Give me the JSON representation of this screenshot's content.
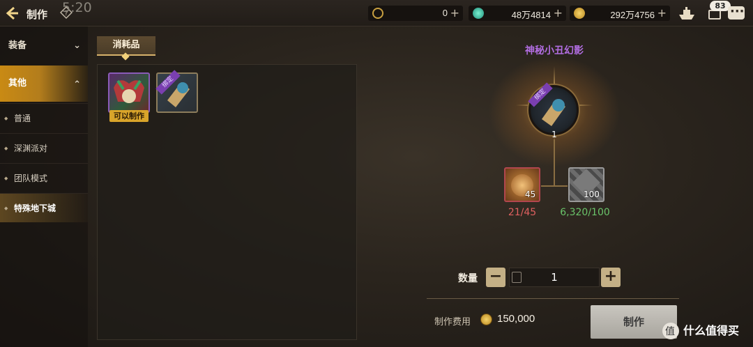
{
  "header": {
    "title": "制作",
    "clock": "5:20",
    "currencies": [
      {
        "icon": "c-coin-icon",
        "value": "0"
      },
      {
        "icon": "gem-icon",
        "value": "48万4814"
      },
      {
        "icon": "gold-icon",
        "value": "292万4756"
      }
    ],
    "mail_badge": "83"
  },
  "sidebar": {
    "categories": [
      {
        "label": "装备",
        "expanded": false
      },
      {
        "label": "其他",
        "expanded": true
      }
    ],
    "items": [
      {
        "label": "普通"
      },
      {
        "label": "深渊派对"
      },
      {
        "label": "团队模式"
      },
      {
        "label": "特殊地下城",
        "active": true
      }
    ]
  },
  "tabs": [
    {
      "label": "消耗品",
      "active": true
    }
  ],
  "recipes": [
    {
      "name_icon": "jester-mask-icon",
      "badge": "可以制作"
    },
    {
      "name_icon": "scroll-icon",
      "ribbon": "绑定"
    }
  ],
  "detail": {
    "title": "神秘小丑幻影",
    "result_ribbon": "绑定",
    "result_count": "1",
    "materials": [
      {
        "icon": "coin-material-icon",
        "count": "45",
        "requirement": "21/45"
      },
      {
        "icon": "crystal-material-icon",
        "count": "100",
        "requirement": "6,320/100"
      }
    ],
    "quantity_label": "数量",
    "quantity": "1",
    "cost_label": "制作费用",
    "cost": "150,000",
    "craft_button": "制作"
  },
  "watermark": "什么值得买",
  "colors": {
    "accent_gold": "#c98a14",
    "title_purple": "#b16de0",
    "insufficient_red": "#e06060",
    "sufficient_green": "#6ac46a"
  }
}
